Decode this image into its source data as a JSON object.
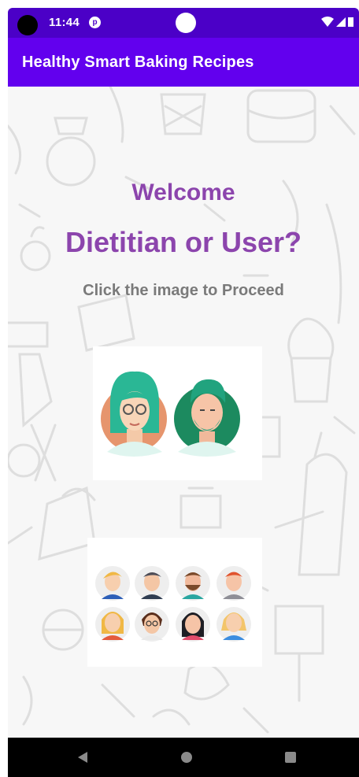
{
  "status_bar": {
    "time": "11:44",
    "app_notification_icon": "p",
    "icons": [
      "wifi-icon",
      "signal-icon",
      "battery-icon"
    ]
  },
  "app_bar": {
    "title": "Healthy Smart Baking Recipes",
    "color": "#6200ee"
  },
  "main": {
    "welcome": "Welcome",
    "headline": "Dietitian or User?",
    "instruction": "Click the image to Proceed",
    "accent_color": "#8c45ad"
  },
  "options": [
    {
      "role": "dietitian",
      "icon": "dietitian-avatars-image"
    },
    {
      "role": "user",
      "icon": "user-avatars-image"
    }
  ],
  "nav_bar": {
    "buttons": [
      "back-icon",
      "home-icon",
      "recents-icon"
    ]
  }
}
